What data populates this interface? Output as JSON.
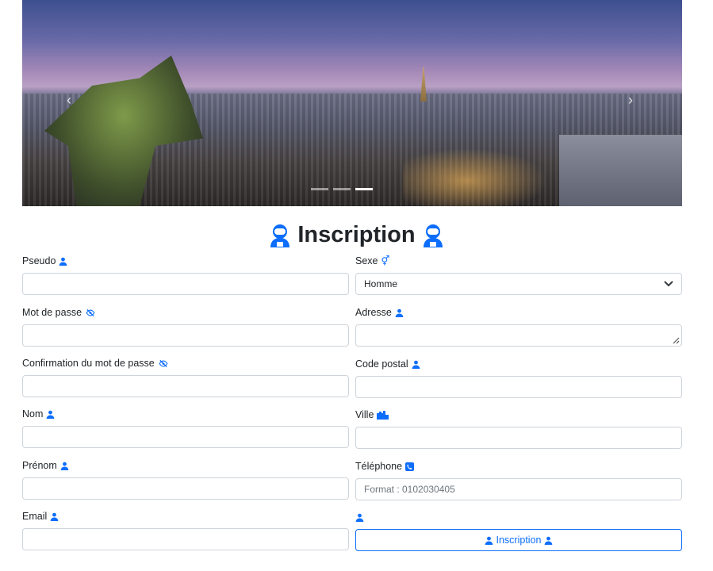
{
  "title": "Inscription",
  "carousel": {
    "slides": 3,
    "active_slide": 3,
    "prev": "‹",
    "next": "›"
  },
  "left": [
    {
      "label": "Pseudo",
      "icon": "user-icon",
      "value": ""
    },
    {
      "label": "Mot de passe",
      "icon": "eye-slash-icon",
      "value": ""
    },
    {
      "label": "Confirmation du mot de passe",
      "icon": "eye-slash-icon",
      "value": ""
    },
    {
      "label": "Nom",
      "icon": "user-icon",
      "value": ""
    },
    {
      "label": "Prénom",
      "icon": "user-icon",
      "value": ""
    },
    {
      "label": "Email",
      "icon": "user-icon",
      "value": ""
    }
  ],
  "right": {
    "sexe": {
      "label": "Sexe",
      "value": "Homme"
    },
    "adresse": {
      "label": "Adresse"
    },
    "code_postal": {
      "label": "Code postal"
    },
    "ville": {
      "label": "Ville"
    },
    "telephone": {
      "label": "Téléphone",
      "placeholder": "Format : 0102030405"
    },
    "submit_label": "Inscription"
  },
  "colors": {
    "accent": "#0d6efd"
  }
}
